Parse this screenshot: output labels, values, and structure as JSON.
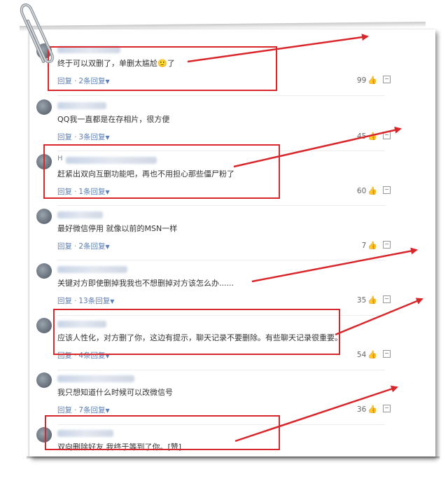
{
  "colors": {
    "highlight": "#d8262b",
    "link": "#5a7fb5",
    "text": "#333333"
  },
  "comments": [
    {
      "name": "",
      "text": "终于可以双删了，单删太尴尬🙂了",
      "reply": "回复",
      "replies": "2条回复",
      "likes": "99"
    },
    {
      "name": "",
      "text": "QQ我一直都是在存相片，很方便",
      "reply": "回复",
      "replies": "3条回复",
      "likes": "45"
    },
    {
      "name": "H",
      "text": "赶紧出双向互删功能吧，再也不用担心那些僵尸粉了",
      "reply": "回复",
      "replies": "1条回复",
      "likes": "60"
    },
    {
      "name": "",
      "text": "最好微信停用 就像以前的MSN一样",
      "reply": "回复",
      "replies": "2条回复",
      "likes": "7"
    },
    {
      "name": "",
      "text": "关键对方即使删掉我我也不想删掉对方该怎么办......",
      "reply": "回复",
      "replies": "13条回复",
      "likes": "35"
    },
    {
      "name": "",
      "text": "应该人性化，对方删了你，这边有提示，聊天记录不要删除。有些聊天记录很重要。",
      "reply": "回复",
      "replies": "4条回复",
      "likes": "54"
    },
    {
      "name": "",
      "text": "我只想知道什么时候可以改微信号",
      "reply": "回复",
      "replies": "7条回复",
      "likes": "36"
    },
    {
      "name": "",
      "text": "双向删除好友 我终于等到了你。[赞]",
      "reply": "",
      "replies": "",
      "likes": ""
    }
  ]
}
